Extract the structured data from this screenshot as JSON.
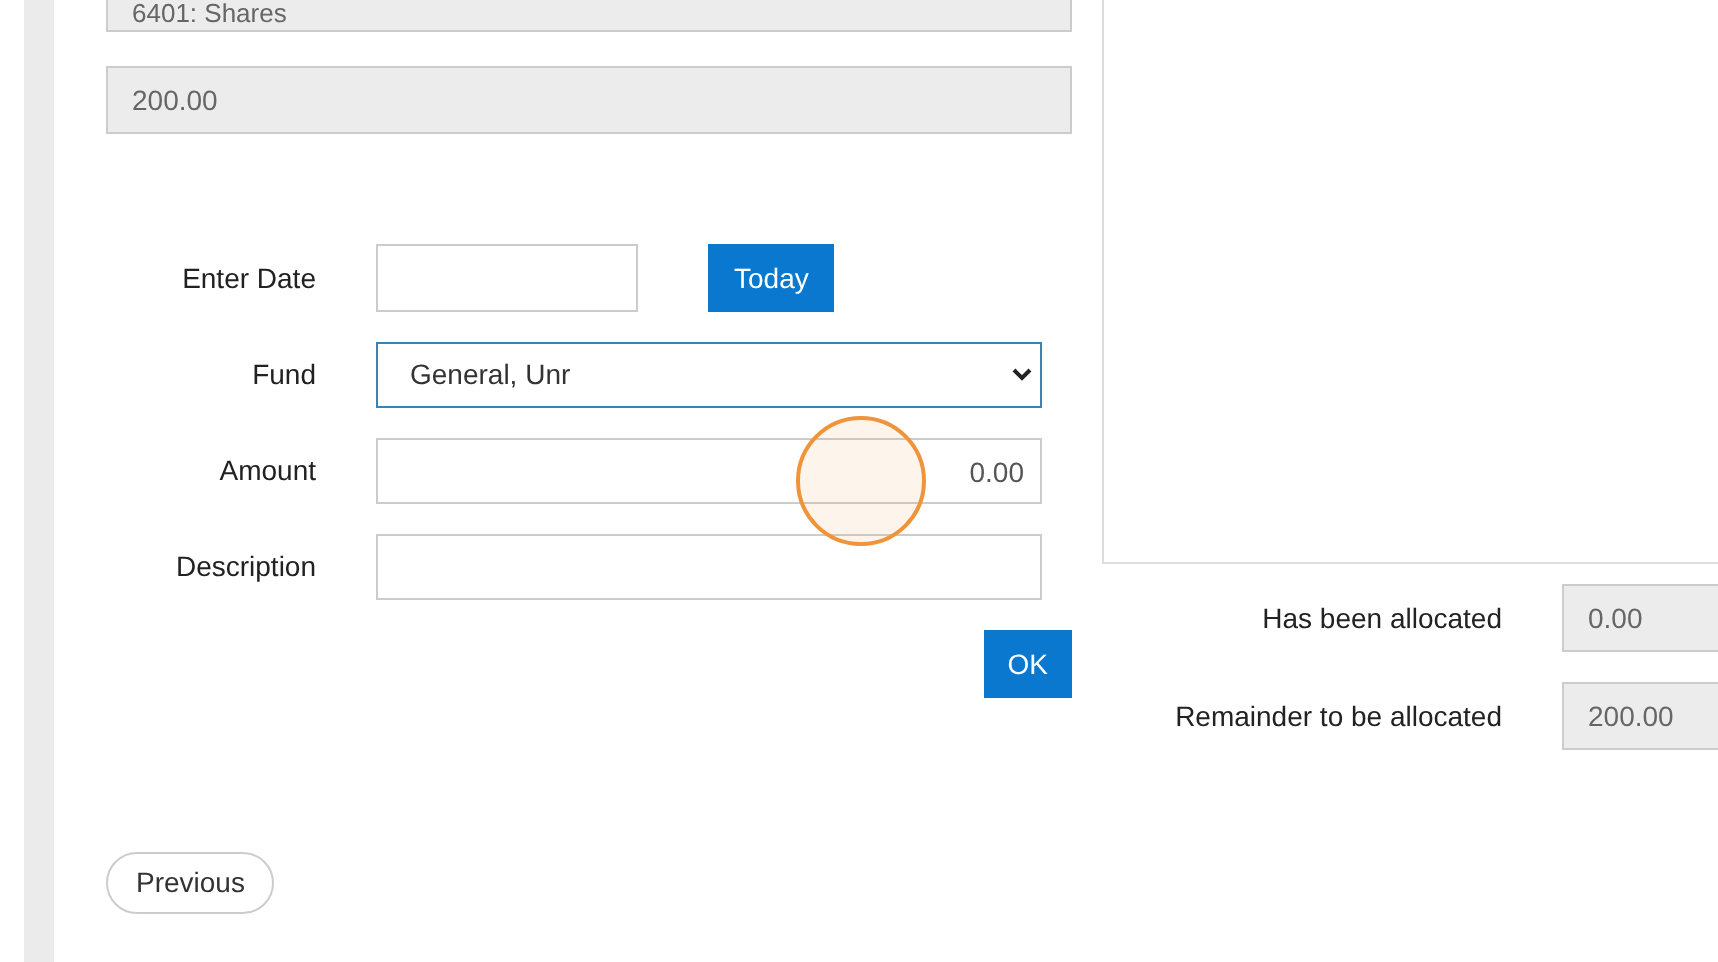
{
  "readonly_fields": [
    {
      "value": "6401: Shares"
    },
    {
      "value": "200.00"
    }
  ],
  "form": {
    "rows": [
      {
        "kind": "date",
        "label": "Enter Date",
        "value": "",
        "button": "Today"
      },
      {
        "kind": "select",
        "label": "Fund",
        "value": "General, Unr"
      },
      {
        "kind": "amount",
        "label": "Amount",
        "value": "0.00"
      },
      {
        "kind": "text",
        "label": "Description",
        "value": ""
      }
    ],
    "ok_button": "OK"
  },
  "allocation": [
    {
      "label": "Has been allocated",
      "value": "0.00"
    },
    {
      "label": "Remainder to be allocated",
      "value": "200.00"
    }
  ],
  "previous_button": "Previous"
}
